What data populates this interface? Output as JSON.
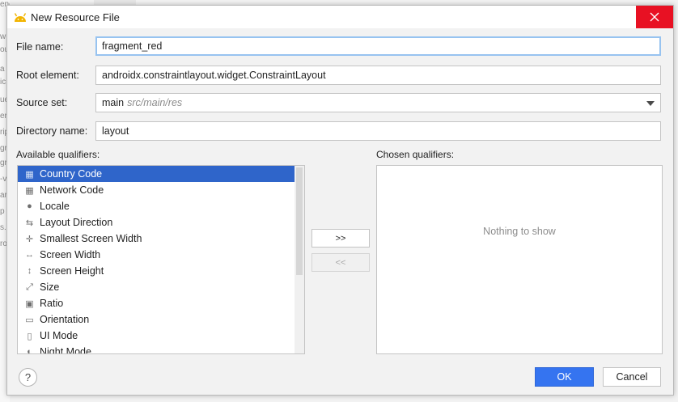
{
  "background": {
    "fragments": [
      "enerated)",
      "w",
      "ou",
      "a",
      "ic",
      "ue",
      "en",
      "rip",
      "gr",
      "gr",
      "-v",
      "ar",
      "p",
      "s.",
      "ro"
    ]
  },
  "dialog": {
    "title": "New Resource File",
    "icon": "android-icon",
    "close_icon": "close-icon"
  },
  "form": {
    "file_name_label": "File name:",
    "file_name_value": "fragment_red",
    "root_element_label": "Root element:",
    "root_element_value": "androidx.constraintlayout.widget.ConstraintLayout",
    "source_set_label": "Source set:",
    "source_set_value": "main",
    "source_set_hint": "src/main/res",
    "directory_name_label": "Directory name:",
    "directory_name_value": "layout"
  },
  "qualifiers": {
    "available_label": "Available qualifiers:",
    "chosen_label": "Chosen qualifiers:",
    "items": [
      {
        "label": "Country Code",
        "icon": "country-code-icon",
        "glyph": "▦",
        "selected": true
      },
      {
        "label": "Network Code",
        "icon": "network-code-icon",
        "glyph": "▦",
        "selected": false
      },
      {
        "label": "Locale",
        "icon": "globe-icon",
        "glyph": "●",
        "selected": false
      },
      {
        "label": "Layout Direction",
        "icon": "layout-direction-icon",
        "glyph": "⇆",
        "selected": false
      },
      {
        "label": "Smallest Screen Width",
        "icon": "smallest-width-icon",
        "glyph": "✛",
        "selected": false
      },
      {
        "label": "Screen Width",
        "icon": "screen-width-icon",
        "glyph": "↔",
        "selected": false
      },
      {
        "label": "Screen Height",
        "icon": "screen-height-icon",
        "glyph": "↕",
        "selected": false
      },
      {
        "label": "Size",
        "icon": "size-icon",
        "glyph": "⤢",
        "selected": false
      },
      {
        "label": "Ratio",
        "icon": "ratio-icon",
        "glyph": "▣",
        "selected": false
      },
      {
        "label": "Orientation",
        "icon": "orientation-icon",
        "glyph": "▭",
        "selected": false
      },
      {
        "label": "UI Mode",
        "icon": "ui-mode-icon",
        "glyph": "▯",
        "selected": false
      },
      {
        "label": "Night Mode",
        "icon": "night-mode-icon",
        "glyph": "◐",
        "selected": false
      }
    ],
    "add_button": ">>",
    "remove_button": "<<",
    "empty_text": "Nothing to show"
  },
  "buttons": {
    "help": "?",
    "ok": "OK",
    "cancel": "Cancel"
  },
  "colors": {
    "accent": "#3574f0",
    "selection": "#2f65ca",
    "close": "#e81123",
    "focus_border": "#97c3f0"
  }
}
